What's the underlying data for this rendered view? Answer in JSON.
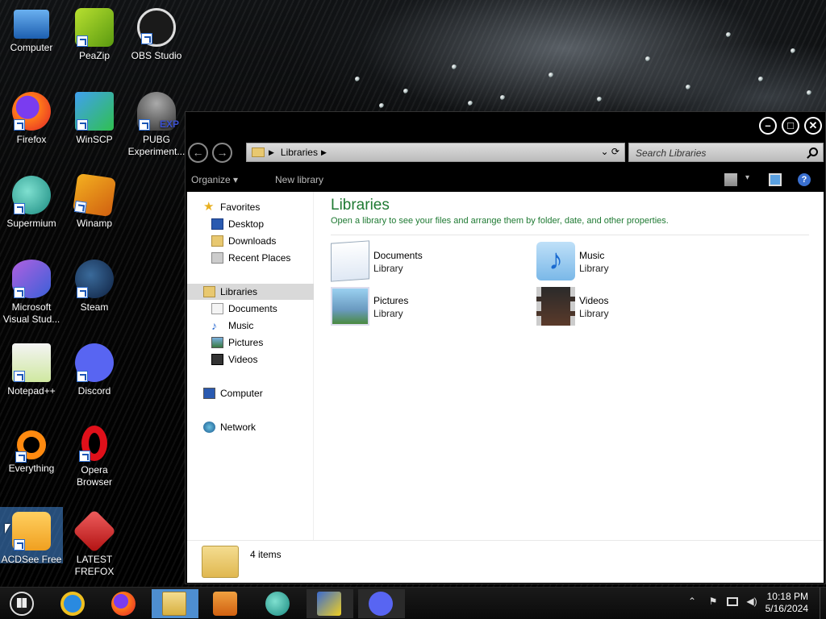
{
  "desktop": {
    "icons": [
      {
        "label": "Computer"
      },
      {
        "label": "PeaZip"
      },
      {
        "label": "OBS Studio"
      },
      {
        "label": "Firefox"
      },
      {
        "label": "WinSCP"
      },
      {
        "label": "PUBG Experiment..."
      },
      {
        "label": "Supermium"
      },
      {
        "label": "Winamp"
      },
      {
        "label": "Microsoft Visual Stud..."
      },
      {
        "label": "Steam"
      },
      {
        "label": "Notepad++"
      },
      {
        "label": "Discord"
      },
      {
        "label": "Everything"
      },
      {
        "label": "Opera Browser"
      },
      {
        "label": "ACDSee Free"
      },
      {
        "label": "LATEST FREFOX"
      }
    ],
    "pubg_badge": "EXP"
  },
  "explorer": {
    "breadcrumb": "Libraries",
    "search_placeholder": "Search Libraries",
    "toolbar": {
      "organize": "Organize",
      "new_library": "New library"
    },
    "nav": {
      "favorites": "Favorites",
      "desktop": "Desktop",
      "downloads": "Downloads",
      "recent_places": "Recent Places",
      "libraries": "Libraries",
      "documents": "Documents",
      "music": "Music",
      "pictures": "Pictures",
      "videos": "Videos",
      "computer": "Computer",
      "network": "Network"
    },
    "main": {
      "title": "Libraries",
      "subtitle": "Open a library to see your files and arrange them by folder, date, and other properties.",
      "items": [
        {
          "name": "Documents",
          "type": "Library"
        },
        {
          "name": "Music",
          "type": "Library"
        },
        {
          "name": "Pictures",
          "type": "Library"
        },
        {
          "name": "Videos",
          "type": "Library"
        }
      ]
    },
    "status": "4 items"
  },
  "taskbar": {
    "time": "10:18 PM",
    "date": "5/16/2024"
  },
  "colors": {
    "accent_green": "#1f7a33",
    "taskbar_active": "#4e8ed0"
  }
}
